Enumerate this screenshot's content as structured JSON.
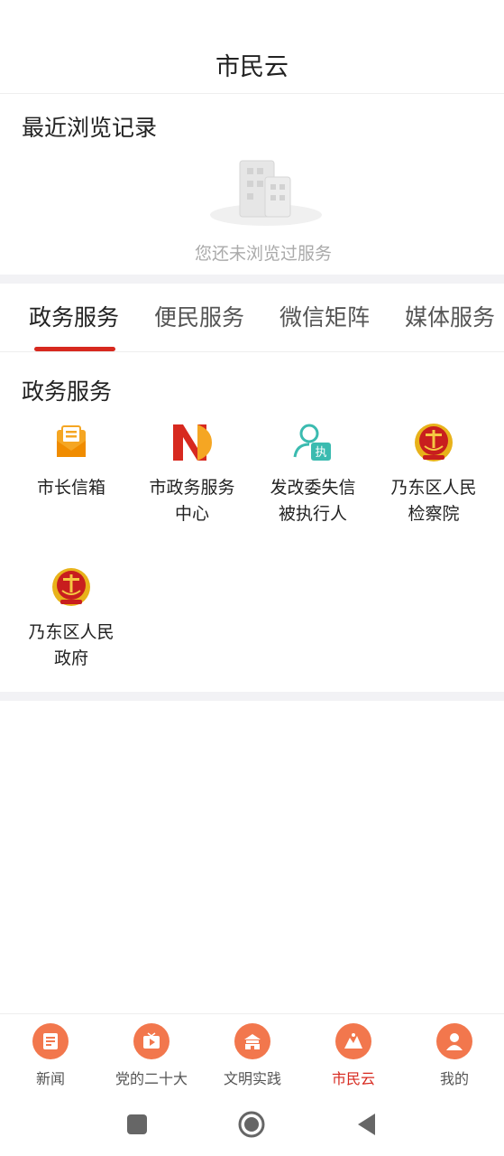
{
  "header": {
    "title": "市民云"
  },
  "recent": {
    "title": "最近浏览记录",
    "empty_text": "您还未浏览过服务"
  },
  "tabs": [
    {
      "label": "政务服务",
      "active": true
    },
    {
      "label": "便民服务",
      "active": false
    },
    {
      "label": "微信矩阵",
      "active": false
    },
    {
      "label": "媒体服务",
      "active": false
    }
  ],
  "services": {
    "title": "政务服务",
    "items": [
      {
        "label": "市长信箱",
        "icon": "mailbox-icon"
      },
      {
        "label": "市政务服务中心",
        "icon": "gov-service-center-logo"
      },
      {
        "label": "发改委失信被执行人",
        "icon": "person-enforce-icon"
      },
      {
        "label": "乃东区人民检察院",
        "icon": "procuratorate-emblem-icon"
      },
      {
        "label": "乃东区人民政府",
        "icon": "government-emblem-icon"
      }
    ]
  },
  "bottom_nav": [
    {
      "label": "新闻",
      "icon": "news-icon",
      "active": false
    },
    {
      "label": "党的二十大",
      "icon": "video-icon",
      "active": false
    },
    {
      "label": "文明实践",
      "icon": "tiananmen-icon",
      "active": false
    },
    {
      "label": "市民云",
      "icon": "city-cloud-icon",
      "active": true
    },
    {
      "label": "我的",
      "icon": "profile-icon",
      "active": false
    }
  ],
  "colors": {
    "accent": "#d7291f",
    "nav_icon_bg": "#f2774d",
    "divider": "#f2f2f5"
  }
}
